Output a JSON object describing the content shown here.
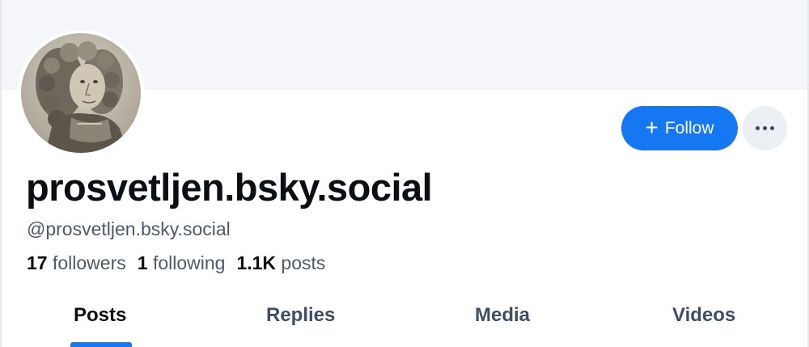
{
  "profile": {
    "display_name": "prosvetljen.bsky.social",
    "handle": "@prosvetljen.bsky.social",
    "avatar_icon": "portrait-avatar"
  },
  "actions": {
    "follow_label": "Follow",
    "follow_icon": "plus-icon",
    "more_icon": "ellipsis-icon"
  },
  "stats": {
    "followers_count": "17",
    "followers_label": "followers",
    "following_count": "1",
    "following_label": "following",
    "posts_count": "1.1K",
    "posts_label": "posts"
  },
  "tabs": [
    {
      "label": "Posts",
      "active": true
    },
    {
      "label": "Replies",
      "active": false
    },
    {
      "label": "Media",
      "active": false
    },
    {
      "label": "Videos",
      "active": false
    }
  ],
  "colors": {
    "accent": "#1577f2",
    "banner": "#f4f6f9",
    "text_primary": "#0b0f14",
    "text_secondary": "#4b5a6c"
  }
}
